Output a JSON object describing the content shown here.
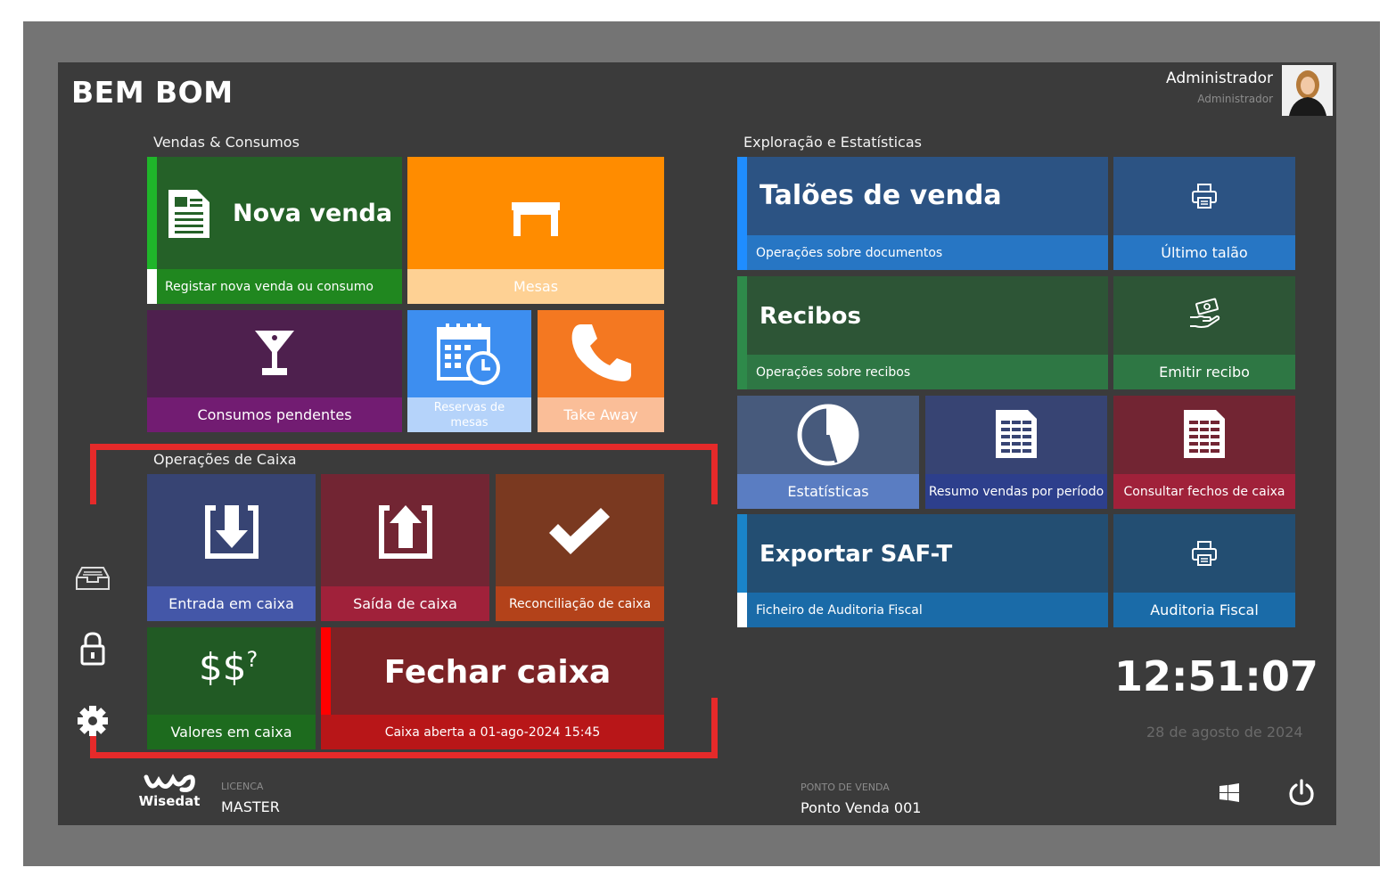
{
  "app_title": "BEM BOM",
  "user": {
    "name": "Administrador",
    "role": "Administrador"
  },
  "sections": {
    "sales": "Vendas & Consumos",
    "cash": "Operações de Caixa",
    "stats": "Exploração e Estatísticas"
  },
  "tiles": {
    "nova_venda": {
      "title": "Nova venda",
      "subtitle": "Registar nova venda ou consumo"
    },
    "mesas": {
      "label": "Mesas"
    },
    "consumos": {
      "label": "Consumos pendentes"
    },
    "reservas": {
      "label_line1": "Reservas de",
      "label_line2": "mesas"
    },
    "takeaway": {
      "label": "Take Away"
    },
    "entrada": {
      "label": "Entrada em caixa"
    },
    "saida": {
      "label": "Saída de caixa"
    },
    "reconciliacao": {
      "label": "Reconciliação de caixa"
    },
    "valores": {
      "label": "Valores em caixa",
      "symbol": "$$",
      "symbol_sup": "?"
    },
    "fechar": {
      "title": "Fechar caixa",
      "subtitle": "Caixa aberta a 01-ago-2024 15:45"
    },
    "taloes": {
      "title": "Talões de venda",
      "subtitle": "Operações sobre documentos"
    },
    "ultimo_talao": {
      "label": "Último talão"
    },
    "recibos": {
      "title": "Recibos",
      "subtitle": "Operações sobre recibos"
    },
    "emitir_recibo": {
      "label": "Emitir recibo"
    },
    "estatisticas": {
      "label": "Estatísticas"
    },
    "resumo": {
      "label": "Resumo vendas por período"
    },
    "fechos": {
      "label": "Consultar fechos de caixa"
    },
    "saft": {
      "title": "Exportar SAF-T",
      "subtitle": "Ficheiro de Auditoria Fiscal"
    },
    "auditoria": {
      "label": "Auditoria Fiscal"
    }
  },
  "clock": {
    "time": "12:51:07",
    "date": "28 de agosto de 2024"
  },
  "footer": {
    "brand": "Wisedat",
    "license_label": "LICENCA",
    "license_value": "MASTER",
    "pos_label": "PONTO DE VENDA",
    "pos_value": "Ponto Venda 001"
  },
  "colors": {
    "nova_venda": "#256128",
    "mesas": "#ff8c00",
    "consumos": "#4e204e",
    "reservas": "#3d8ef0",
    "takeaway": "#f47821",
    "entrada": "#374473",
    "saida": "#722533",
    "reconciliacao": "#7a3920",
    "valores": "#215a24",
    "fechar": "#7c2326",
    "taloes": "#2c5383",
    "recibos": "#2d5536",
    "estatisticas": "#475a7c",
    "resumo": "#374473",
    "fechos": "#722533",
    "saft": "#234e72",
    "highlight_box": "#e52a2a"
  },
  "icons": {
    "side": [
      "cash-drawer-icon",
      "lock-icon",
      "gear-icon"
    ],
    "footer": [
      "windows-icon",
      "power-icon"
    ]
  }
}
